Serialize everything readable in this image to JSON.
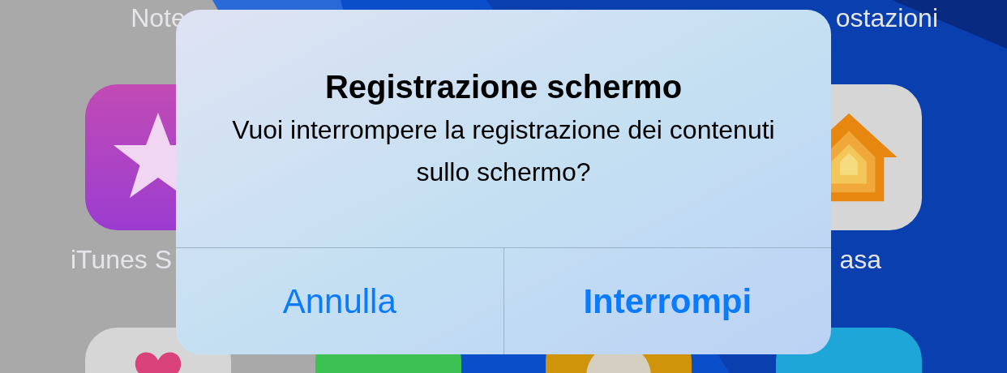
{
  "home_screen": {
    "top_labels": [
      "Note",
      "ostazioni"
    ],
    "apps": [
      {
        "label": "iTunes S",
        "kind": "star"
      },
      {
        "label": "asa",
        "kind": "house"
      }
    ],
    "bottom_apps": [
      {
        "kind": "heart"
      },
      {
        "kind": "green"
      },
      {
        "kind": "circle"
      },
      {
        "kind": "blue"
      }
    ]
  },
  "alert": {
    "title": "Registrazione schermo",
    "message": "Vuoi interrompere la registrazione dei contenuti sullo schermo?",
    "buttons": [
      {
        "label": "Annulla",
        "bold": false
      },
      {
        "label": "Interrompi",
        "bold": true
      }
    ]
  }
}
